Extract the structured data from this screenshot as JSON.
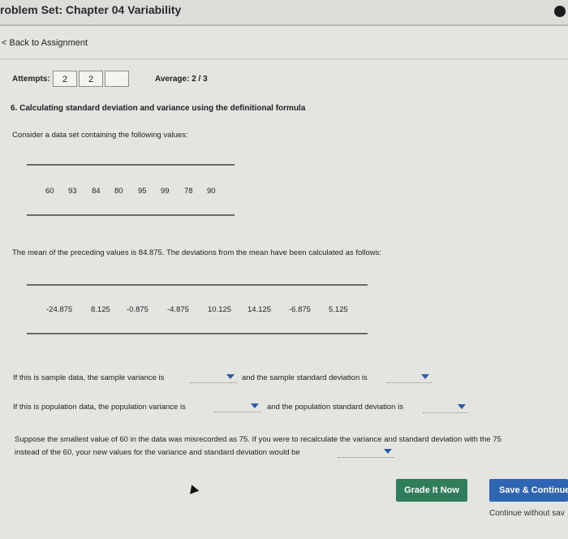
{
  "header": {
    "title": "roblem Set: Chapter 04 Variability"
  },
  "nav": {
    "back": "< Back to Assignment"
  },
  "attempts": {
    "label": "Attempts:",
    "boxes": [
      "2",
      "2",
      ""
    ],
    "average_label": "Average:",
    "average_value": "2 / 3"
  },
  "question": {
    "title": "6. Calculating standard deviation and variance using the definitional formula",
    "intro": "Consider a data set containing the following values:",
    "values": [
      "60",
      "93",
      "84",
      "80",
      "95",
      "99",
      "78",
      "90"
    ],
    "mean_text": "The mean of the preceding values is 84.875. The deviations from the mean have been calculated as follows:",
    "deviations": [
      "-24.875",
      "8.125",
      "-0.875",
      "-4.875",
      "10.125",
      "14.125",
      "-6.875",
      "5.125"
    ],
    "sample_line_a": "If this is sample data, the sample variance is",
    "sample_line_b": "and the sample standard deviation is",
    "pop_line_a": "If this is population data, the population variance is",
    "pop_line_b": "and the population standard deviation is",
    "misrec_line1": "Suppose the smallest value of 60 in the data was misrecorded as 75. If you were to recalculate the variance and standard deviation with the 75",
    "misrec_line2": "instead of the 60, your new values for the variance and standard deviation would be"
  },
  "buttons": {
    "grade": "Grade It Now",
    "save": "Save & Continue",
    "continue_without": "Continue without sav"
  },
  "colors": {
    "grade": "#2f7d5b",
    "save": "#2f66b3",
    "dropdown_arrow": "#2a5ba8"
  }
}
